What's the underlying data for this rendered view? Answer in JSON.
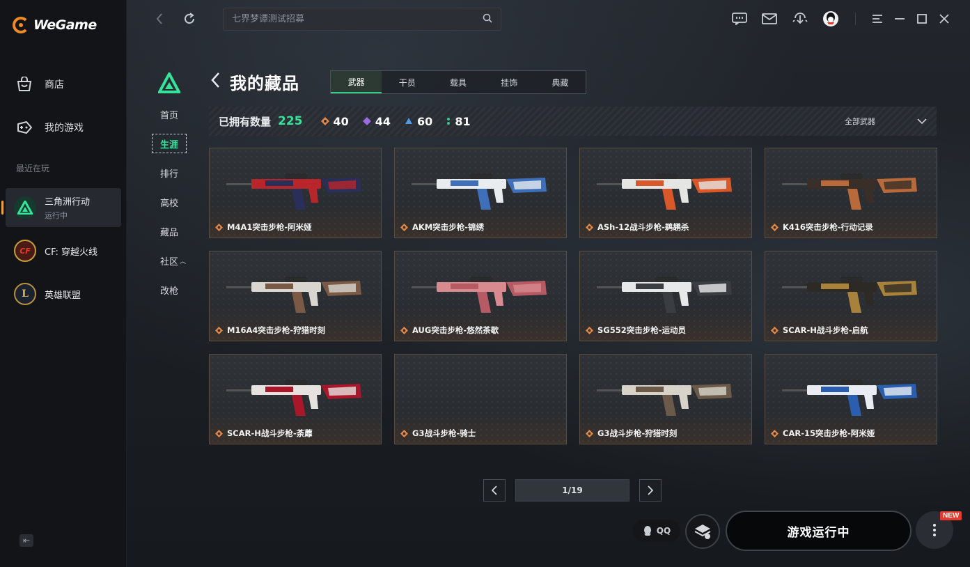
{
  "app": {
    "name": "WeGame"
  },
  "sidebar": {
    "nav": [
      {
        "label": "商店",
        "icon": "store-bag-icon"
      },
      {
        "label": "我的游戏",
        "icon": "gamepad-icon"
      }
    ],
    "recent_label": "最近在玩",
    "games": [
      {
        "name": "三角洲行动",
        "status": "运行中",
        "active": true
      },
      {
        "name": "CF: 穿越火线",
        "status": ""
      },
      {
        "name": "英雄联盟",
        "status": ""
      }
    ]
  },
  "search": {
    "placeholder": "七界梦谭测试招募"
  },
  "subnav": [
    "首页",
    "生涯",
    "排行",
    "高校",
    "藏品",
    "社区",
    "改枪"
  ],
  "page": {
    "title": "我的藏品",
    "tabs": [
      "武器",
      "干员",
      "载具",
      "挂饰",
      "典藏"
    ],
    "active_tab": "武器"
  },
  "stats": {
    "label": "已拥有数量",
    "total": "225",
    "counts": [
      {
        "num": "40",
        "color": "#e2894a"
      },
      {
        "num": "44",
        "color": "#9a6ae0"
      },
      {
        "num": "60",
        "color": "#4f9be6"
      },
      {
        "num": "81",
        "color": "#39c98c"
      }
    ],
    "filter": "全部武器"
  },
  "weapons": [
    {
      "name": "M4A1突击步枪-阿米娅",
      "c1": "#b8262b",
      "c2": "#2a2f5a"
    },
    {
      "name": "AKM突击步枪-锦绣",
      "c1": "#e8ecef",
      "c2": "#3f6fb8"
    },
    {
      "name": "ASh-12战斗步枪-鹈鹕杀",
      "c1": "#e5e5e3",
      "c2": "#d9582a"
    },
    {
      "name": "K416突击步枪-行动记录",
      "c1": "#3a2f28",
      "c2": "#b86a3a"
    },
    {
      "name": "M16A4突击步枪-狩猎时刻",
      "c1": "#d8d6cf",
      "c2": "#7a5a44"
    },
    {
      "name": "AUG突击步枪-悠然茶歇",
      "c1": "#d88a8f",
      "c2": "#b65a63"
    },
    {
      "name": "SG552突击步枪-运动员",
      "c1": "#e7e8ea",
      "c2": "#3a3d42"
    },
    {
      "name": "SCAR-H战斗步枪-启航",
      "c1": "#2d2a26",
      "c2": "#a8823a"
    },
    {
      "name": "SCAR-H战斗步枪-荼蘼",
      "c1": "#e6e2e0",
      "c2": "#a8182a"
    },
    {
      "name": "G3战斗步枪-骑士",
      "c1": "",
      "c2": ""
    },
    {
      "name": "G3战斗步枪-狩猎时刻",
      "c1": "#d7d3c9",
      "c2": "#6b5a4a"
    },
    {
      "name": "CAR-15突击步枪-阿米娅",
      "c1": "#e9edf3",
      "c2": "#2a5fb0"
    }
  ],
  "pager": {
    "page": "1/19"
  },
  "bottom": {
    "qq": "QQ",
    "launch": "游戏运行中",
    "badge": "NEW"
  }
}
